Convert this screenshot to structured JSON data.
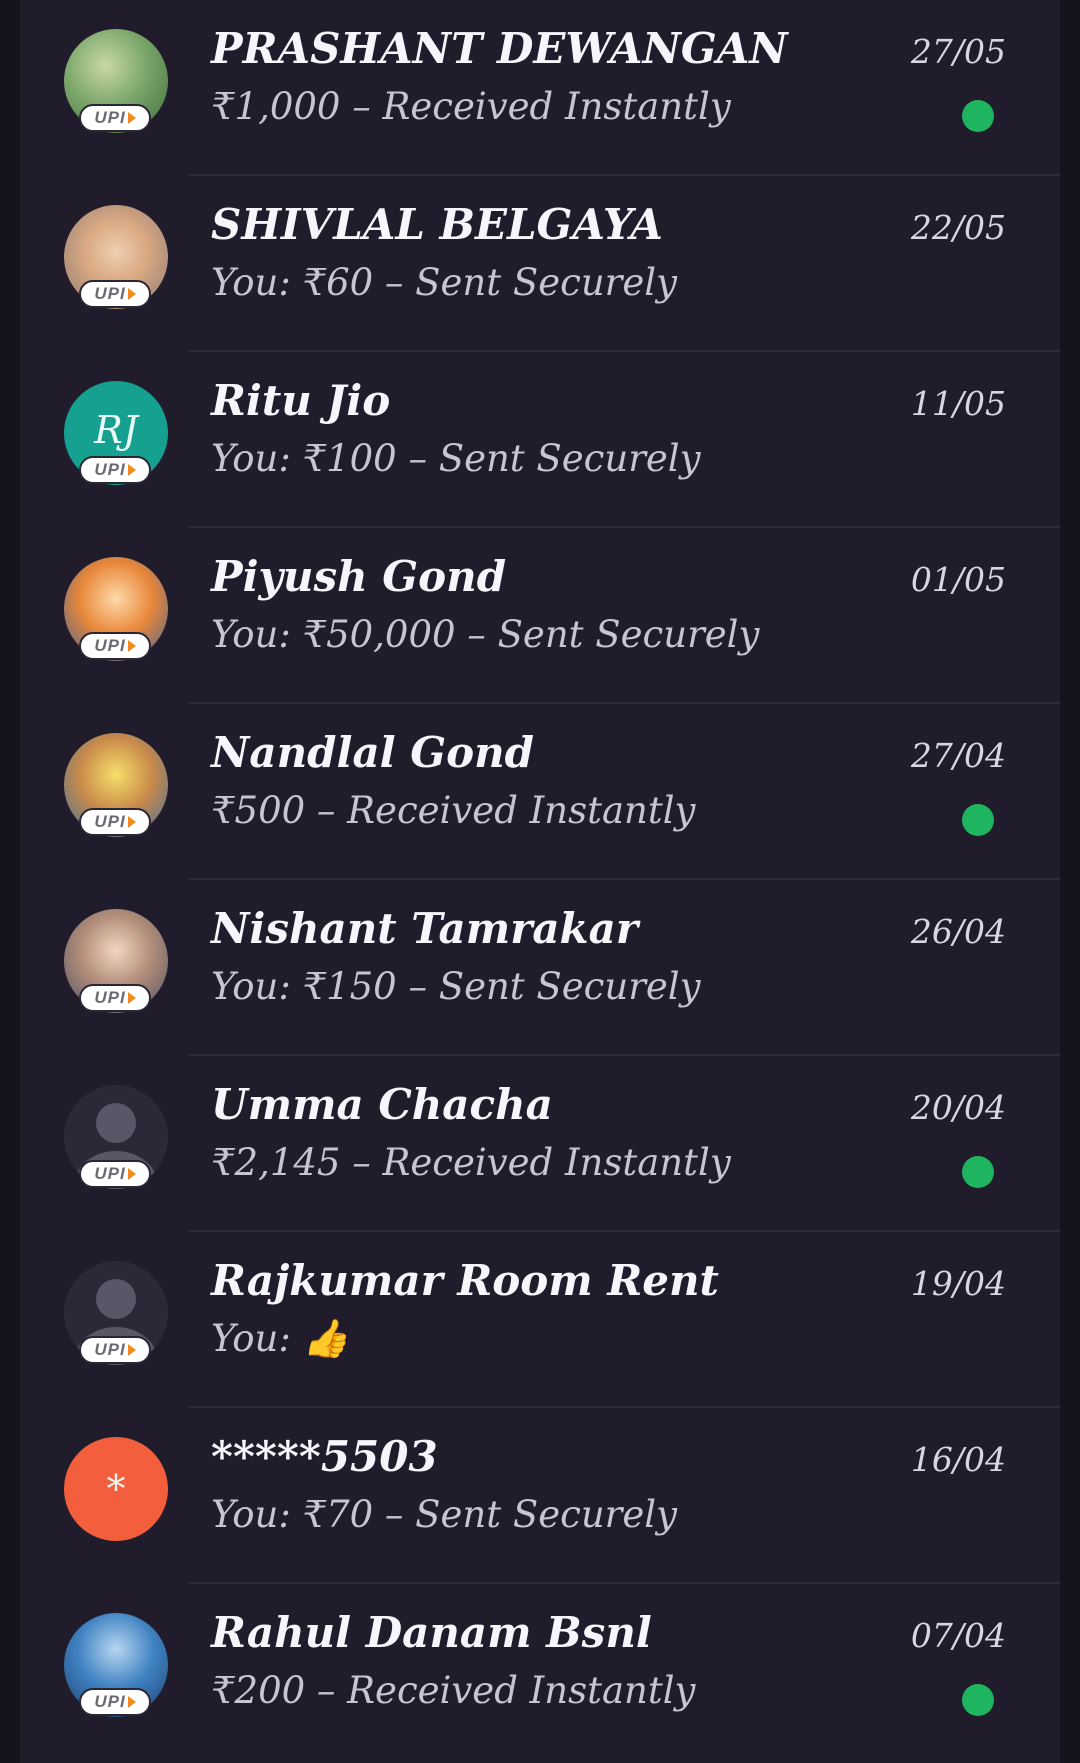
{
  "badge_text": "UPI",
  "colors": {
    "background": "#201c2b",
    "unread_dot": "#1fb45f",
    "teal_avatar": "#16a08f",
    "orange_avatar": "#f35f3d"
  },
  "conversations": [
    {
      "name": "PRASHANT  DEWANGAN",
      "subtitle": "₹1,000 – Received Instantly",
      "date": "27/05",
      "unread": true,
      "avatar": "photo"
    },
    {
      "name": "SHIVLAL BELGAYA",
      "subtitle": "You: ₹60 – Sent Securely",
      "date": "22/05",
      "unread": false,
      "avatar": "photo"
    },
    {
      "name": "Ritu Jio",
      "subtitle": "You: ₹100 – Sent Securely",
      "date": "11/05",
      "unread": false,
      "avatar": "initials",
      "initials": "RJ"
    },
    {
      "name": "Piyush Gond",
      "subtitle": "You: ₹50,000 – Sent Securely",
      "date": "01/05",
      "unread": false,
      "avatar": "photo"
    },
    {
      "name": "Nandlal Gond",
      "subtitle": "₹500 – Received Instantly",
      "date": "27/04",
      "unread": true,
      "avatar": "photo"
    },
    {
      "name": "Nishant Tamrakar",
      "subtitle": "You: ₹150 – Sent Securely",
      "date": "26/04",
      "unread": false,
      "avatar": "photo"
    },
    {
      "name": "Umma Chacha",
      "subtitle": "₹2,145 – Received Instantly",
      "date": "20/04",
      "unread": true,
      "avatar": "default-person-icon"
    },
    {
      "name": "Rajkumar Room Rent",
      "subtitle": "You: 👍",
      "date": "19/04",
      "unread": false,
      "avatar": "default-person-icon"
    },
    {
      "name": "*****5503",
      "subtitle": "You: ₹70 – Sent Securely",
      "date": "16/04",
      "unread": false,
      "avatar": "initials",
      "initials": "*"
    },
    {
      "name": "Rahul Danam Bsnl",
      "subtitle": "₹200 – Received Instantly",
      "date": "07/04",
      "unread": true,
      "avatar": "photo"
    }
  ]
}
